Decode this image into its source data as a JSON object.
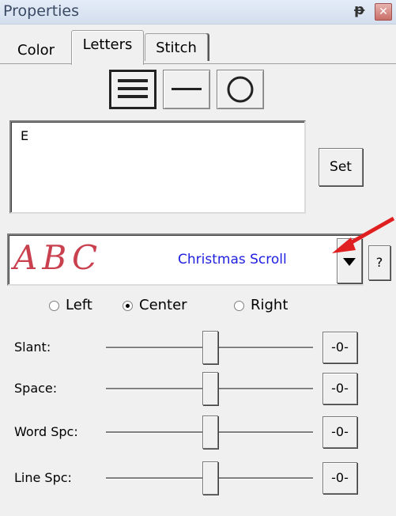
{
  "panel": {
    "title": "Properties"
  },
  "tabs": [
    {
      "label": "Color"
    },
    {
      "label": "Letters"
    },
    {
      "label": "Stitch"
    }
  ],
  "text_input": {
    "value": "E"
  },
  "set_button": "Set",
  "font": {
    "preview": "ABC",
    "name": "Christmas Scroll",
    "help_button": "?"
  },
  "alignment": {
    "options": [
      "Left",
      "Center",
      "Right"
    ],
    "selected": "Center"
  },
  "sliders": [
    {
      "label": "Slant:",
      "reset": "-0-",
      "value": 0.5
    },
    {
      "label": "Space:",
      "reset": "-0-",
      "value": 0.5
    },
    {
      "label": "Word Spc:",
      "reset": "-0-",
      "value": 0.5
    },
    {
      "label": "Line Spc:",
      "reset": "-0-",
      "value": 0.5
    }
  ],
  "colors": {
    "font_name": "#2020e0",
    "preview": "#c02030",
    "annotation_arrow": "#e02020"
  }
}
